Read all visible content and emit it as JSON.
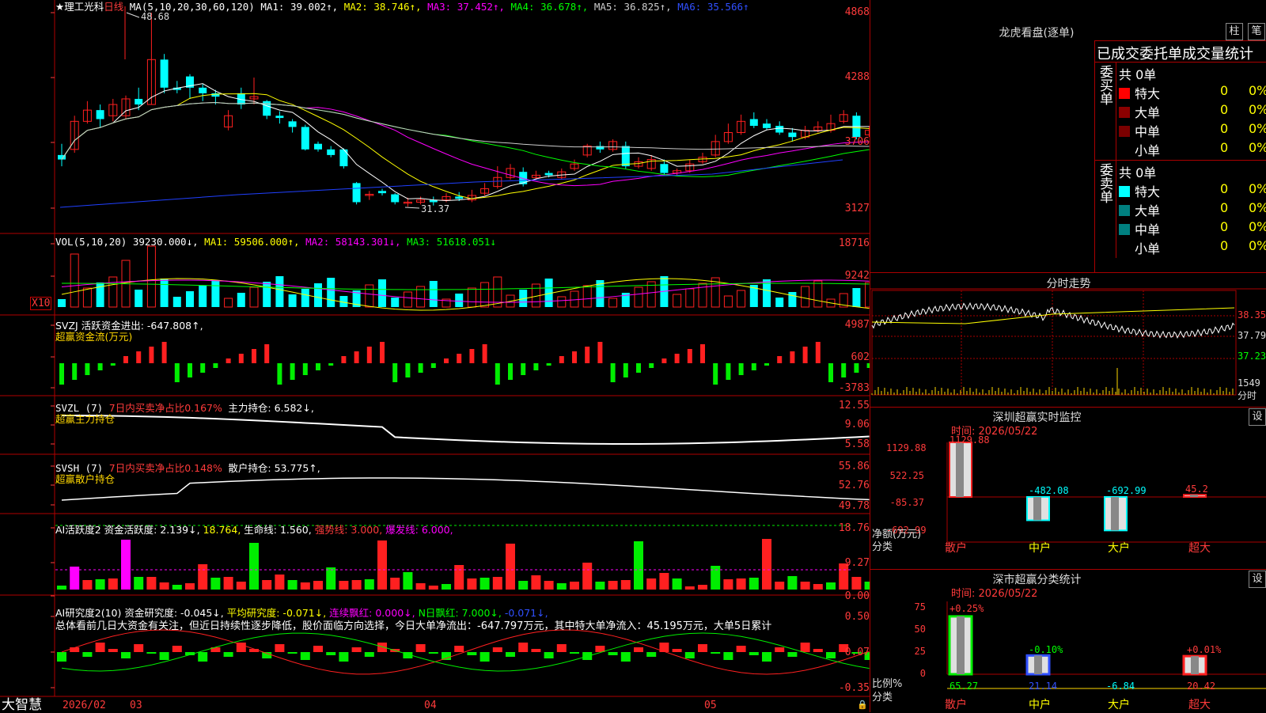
{
  "left": {
    "price_axis": [
      "4868",
      "4288",
      "3706",
      "3127"
    ],
    "vol_axis": [
      "18716",
      "9242"
    ],
    "vol_unit": "X10",
    "svzj_axis": [
      "4987",
      "602",
      "-3783"
    ],
    "svzl_axis": [
      "12.55",
      "9.06",
      "5.58"
    ],
    "svsh_axis": [
      "55.86",
      "52.76",
      "49.78"
    ],
    "ai_axis": [
      "18.76",
      "9.27",
      "0.00"
    ],
    "ai2_axis": [
      "0.50",
      "0.07",
      "-0.35"
    ],
    "title_prefix": "★理工光科",
    "title_period": "日线",
    "ma_label": "MA(5,10,20,30,60,120)",
    "ma1": "MA1: 39.002↑,",
    "ma2": "MA2: 38.746↑,",
    "ma3": "MA3: 37.452↑,",
    "ma4": "MA4: 36.678↑,",
    "ma5": "MA5: 36.825↑,",
    "ma6": "MA6: 35.566↑",
    "high_mark": "48.68",
    "low_mark": "31.37",
    "vol_label": "VOL(5,10,20)",
    "vol_val": "39230.000↓,",
    "vol_ma1": "MA1: 59506.000↑,",
    "vol_ma2": "MA2: 58143.301↓,",
    "vol_ma3": "MA3: 51618.051↓",
    "svzj_label": "SVZJ  活跃资金进出: -647.808↑,",
    "svzj_title": "超赢资金流(万元)",
    "svzl_label": "SVZL (7)",
    "svzl_ratio": "7日内买卖净占比0.167%",
    "svzl_main": "主力持仓: 6.582↓,",
    "svzl_title": "超赢主力持仓",
    "svsh_label": "SVSH (7)",
    "svsh_ratio": "7日内买卖净占比0.148%",
    "svsh_retail": "散户持仓: 53.775↑,",
    "svsh_title": "超赢散户持仓",
    "ai_label": "AI活跃度2 资金活跃度: 2.139↓,",
    "ai_v2": "18.764,",
    "ai_life": "生命线: 1.560,",
    "ai_strong": "强势线: 3.000,",
    "ai_burst": "爆发线: 6.000,",
    "ai2_label": "AI研究度2(10) 资金研究度: -0.045↓,",
    "ai2_avg": "平均研究度: -0.071↓,",
    "ai2_lx": "连续飘红: 0.000↓,",
    "ai2_n": "N日飘红: 7.000↓,",
    "ai2_last": "-0.071↓,",
    "summary": "总体看前几日大资金有关注，但近日持续性逐步降低，股价面临方向选择，今日大单净流出：-647.797万元，其中特大单净流入：45.195万元，大单5日累计",
    "brand": "大智慧",
    "date_labels": [
      "2026/02",
      "03",
      "04",
      "05"
    ]
  },
  "right": {
    "lhb_title": "龙虎看盘(逐单)",
    "btn_zhu": "柱",
    "btn_bi": "笔",
    "tabs": "已成交委托单成交量统计",
    "buy_side": "委买单",
    "sell_side": "委卖单",
    "buy_total": "共 0单",
    "sell_total": "共 0单",
    "rows": [
      {
        "label": "特大",
        "v": "0",
        "p": "0%"
      },
      {
        "label": "大单",
        "v": "0",
        "p": "0%"
      },
      {
        "label": "中单",
        "v": "0",
        "p": "0%"
      },
      {
        "label": "小单",
        "v": "0",
        "p": "0%"
      }
    ],
    "buy_colors": [
      "#ff0000",
      "#8b0000",
      "#7a0000",
      "#000"
    ],
    "sell_colors": [
      "#00ffff",
      "#008080",
      "#008080",
      "#000"
    ],
    "fs_title": "分时走势",
    "fs_axis": [
      "38.35",
      "37.79",
      "37.23",
      "1549"
    ],
    "fs_unit": "分时",
    "sz_title": "深圳超赢实时监控",
    "btn_set": "设",
    "sz_time": "时间: 2026/05/22",
    "sz_axis": [
      "1129.88",
      "522.25",
      "-85.37",
      "-692.99"
    ],
    "sz_vals": [
      "1129.88",
      "-482.08",
      "-692.99",
      "45.2"
    ],
    "sz_net": "净额(万元)",
    "sz_cat": "分类",
    "cats": [
      "散户",
      "中户",
      "大户",
      "超大"
    ],
    "ss_title": "深市超赢分类统计",
    "ss_time": "时间: 2026/05/22",
    "ss_axis": [
      "75",
      "50",
      "25",
      "0"
    ],
    "ss_top": [
      "+0.25%",
      "-0.10%",
      "+0.01%"
    ],
    "ss_vals": [
      "65.27",
      "21.14",
      "-6.84",
      "20.42"
    ],
    "ss_ratio": "比例%",
    "ss_cat": "分类"
  }
}
